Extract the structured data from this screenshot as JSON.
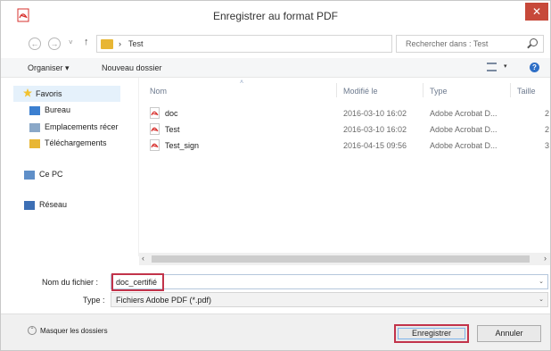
{
  "window": {
    "title": "Enregistrer au format PDF",
    "close_glyph": "✕"
  },
  "navigation": {
    "back_glyph": "←",
    "forward_glyph": "→",
    "history_glyph": "˅",
    "up_glyph": "↑",
    "breadcrumb_separator": "›",
    "breadcrumb": "Test",
    "address_dropdown_glyph": "⌄",
    "refresh_glyph": "↻",
    "search_placeholder": "Rechercher dans : Test"
  },
  "commands": {
    "organize_label": "Organiser ▾",
    "new_folder_label": "Nouveau dossier",
    "view_dropdown_glyph": "▾",
    "help_glyph": "?"
  },
  "sidebar": {
    "favorites": {
      "label": "Favoris",
      "icon": "star-icon"
    },
    "favorite_items": [
      {
        "label": "Bureau",
        "icon": "desktop-icon"
      },
      {
        "label": "Emplacements récer",
        "icon": "recent-places-icon"
      },
      {
        "label": "Téléchargements",
        "icon": "downloads-icon"
      }
    ],
    "this_pc": {
      "label": "Ce PC",
      "icon": "computer-icon"
    },
    "network": {
      "label": "Réseau",
      "icon": "network-icon"
    }
  },
  "file_list": {
    "columns": {
      "name": "Nom",
      "modified": "Modifié le",
      "type": "Type",
      "size": "Taille",
      "sort_glyph": "˄"
    },
    "rows": [
      {
        "name": "doc",
        "modified": "2016-03-10 16:02",
        "type": "Adobe Acrobat D...",
        "size": "2"
      },
      {
        "name": "Test",
        "modified": "2016-03-10 16:02",
        "type": "Adobe Acrobat D...",
        "size": "2"
      },
      {
        "name": "Test_sign",
        "modified": "2016-04-15 09:56",
        "type": "Adobe Acrobat D...",
        "size": "3"
      }
    ]
  },
  "scrollbar": {
    "left_glyph": "‹",
    "right_glyph": "›"
  },
  "save_form": {
    "filename_label": "Nom du fichier :",
    "filename_value": "doc_certifié",
    "filename_dropdown_glyph": "⌄",
    "type_label": "Type :",
    "type_value": "Fichiers Adobe PDF (*.pdf)",
    "type_dropdown_glyph": "⌄"
  },
  "footer": {
    "hide_folders_glyph": "⌃",
    "hide_folders_label": "Masquer les dossiers",
    "save_button": "Enregistrer",
    "cancel_button": "Annuler"
  },
  "colors": {
    "close_button": "#c7493a",
    "highlight_outline": "#c2334a",
    "folder": "#e8b634",
    "pdf_red": "#d7302d",
    "selection": "#e5f1fb",
    "help_blue": "#2f6fc6"
  }
}
